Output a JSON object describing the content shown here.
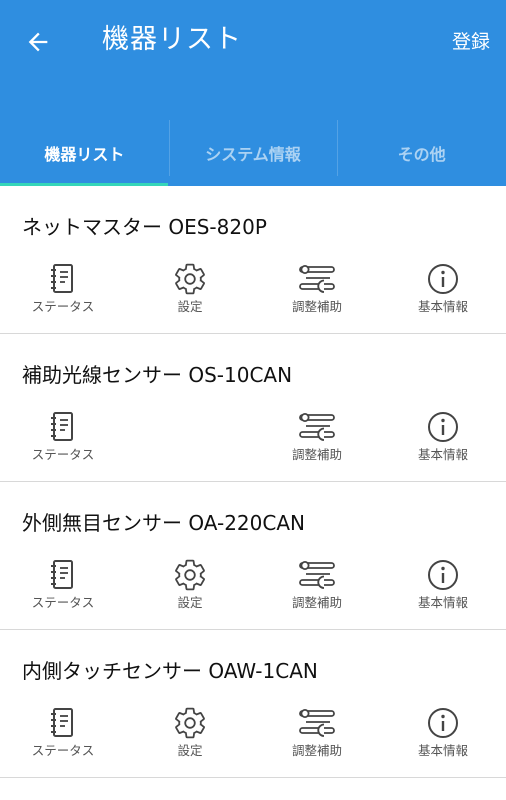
{
  "header": {
    "title": "機器リスト",
    "register_label": "登録",
    "back_icon": "arrow-left-icon"
  },
  "tabs": [
    {
      "label": "機器リスト",
      "active": true
    },
    {
      "label": "システム情報",
      "active": false
    },
    {
      "label": "その他",
      "active": false
    }
  ],
  "colors": {
    "appbar": "#2f8ee0",
    "tab_indicator": "#35d6b9",
    "icon": "#444444"
  },
  "devices": [
    {
      "name": "ネットマスター OES-820P",
      "actions": [
        {
          "label": "ステータス",
          "icon": "notebook-icon"
        },
        {
          "label": "設定",
          "icon": "gear-icon"
        },
        {
          "label": "調整補助",
          "icon": "tools-icon"
        },
        {
          "label": "基本情報",
          "icon": "info-icon"
        }
      ]
    },
    {
      "name": "補助光線センサー OS-10CAN",
      "actions": [
        {
          "label": "ステータス",
          "icon": "notebook-icon"
        },
        {
          "label": "調整補助",
          "icon": "tools-icon"
        },
        {
          "label": "基本情報",
          "icon": "info-icon"
        }
      ]
    },
    {
      "name": "外側無目センサー OA-220CAN",
      "actions": [
        {
          "label": "ステータス",
          "icon": "notebook-icon"
        },
        {
          "label": "設定",
          "icon": "gear-icon"
        },
        {
          "label": "調整補助",
          "icon": "tools-icon"
        },
        {
          "label": "基本情報",
          "icon": "info-icon"
        }
      ]
    },
    {
      "name": "内側タッチセンサー OAW-1CAN",
      "actions": [
        {
          "label": "ステータス",
          "icon": "notebook-icon"
        },
        {
          "label": "設定",
          "icon": "gear-icon"
        },
        {
          "label": "調整補助",
          "icon": "tools-icon"
        },
        {
          "label": "基本情報",
          "icon": "info-icon"
        }
      ]
    }
  ]
}
